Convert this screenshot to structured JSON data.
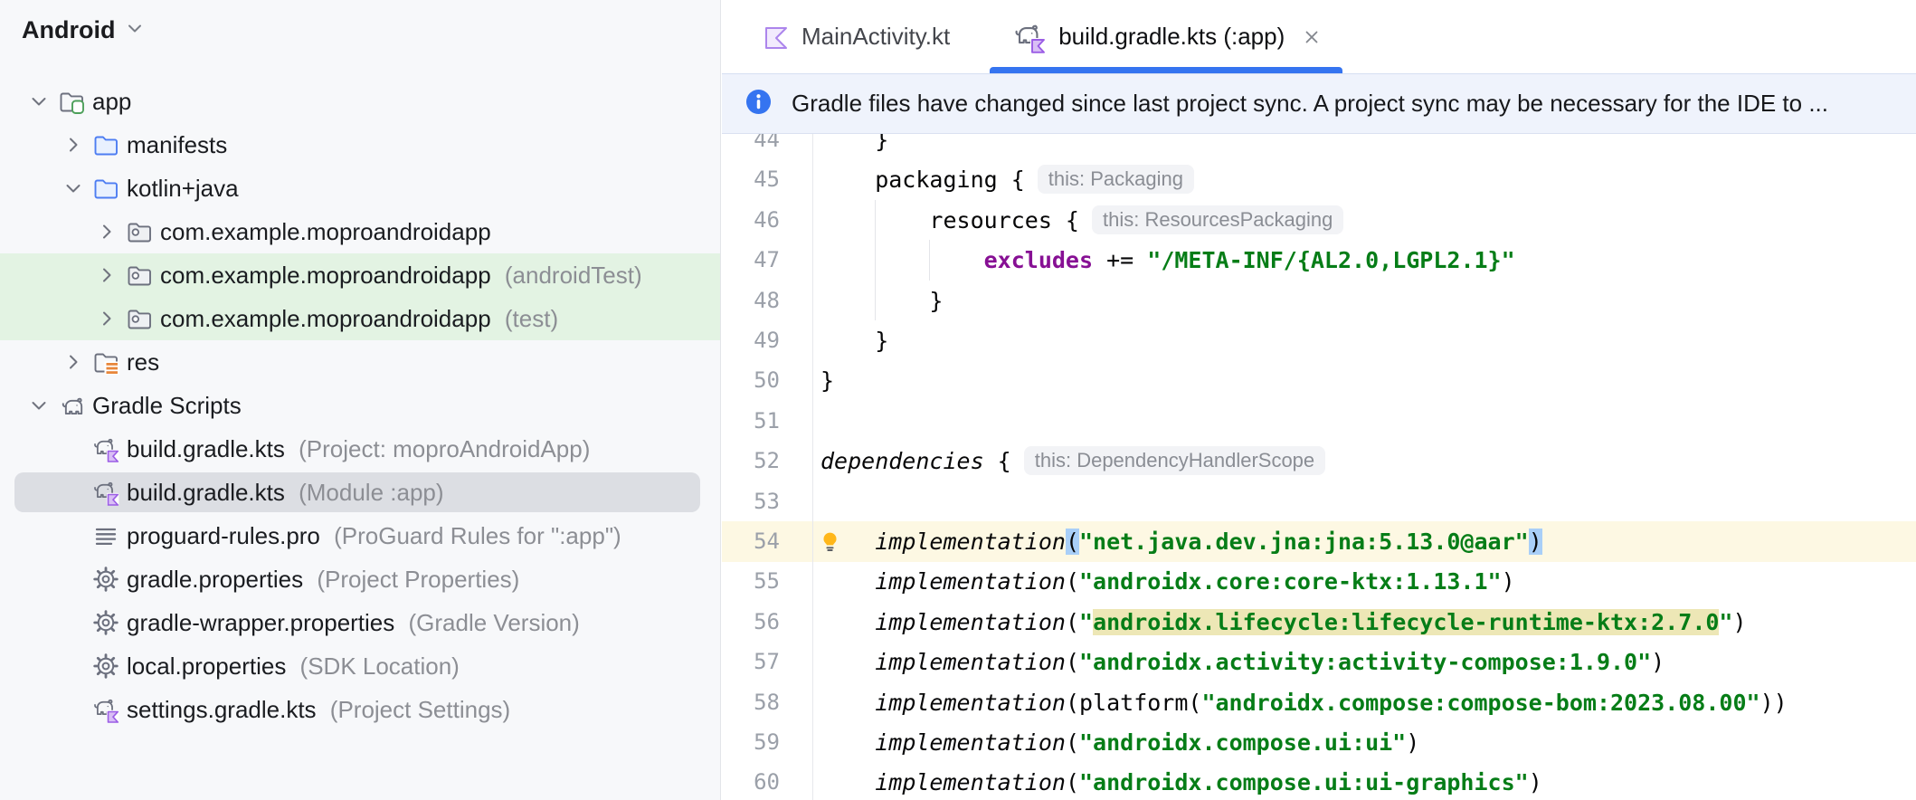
{
  "sidebar": {
    "view_selector": {
      "label": "Android"
    },
    "tree": [
      {
        "label": "app",
        "suffix": "",
        "icon": "folder-module",
        "chevron": "down",
        "indent": 0,
        "highlight": "none"
      },
      {
        "label": "manifests",
        "suffix": "",
        "icon": "folder-blue",
        "chevron": "right",
        "indent": 1,
        "highlight": "none"
      },
      {
        "label": "kotlin+java",
        "suffix": "",
        "icon": "folder-blue",
        "chevron": "down",
        "indent": 1,
        "highlight": "none"
      },
      {
        "label": "com.example.moproandroidapp",
        "suffix": "",
        "icon": "package-folder",
        "chevron": "right",
        "indent": 2,
        "highlight": "none"
      },
      {
        "label": "com.example.moproandroidapp",
        "suffix": "(androidTest)",
        "icon": "package-folder",
        "chevron": "right",
        "indent": 2,
        "highlight": "green"
      },
      {
        "label": "com.example.moproandroidapp",
        "suffix": "(test)",
        "icon": "package-folder",
        "chevron": "right",
        "indent": 2,
        "highlight": "green"
      },
      {
        "label": "res",
        "suffix": "",
        "icon": "folder-res",
        "chevron": "right",
        "indent": 1,
        "highlight": "none"
      },
      {
        "label": "Gradle Scripts",
        "suffix": "",
        "icon": "gradle-elephant",
        "chevron": "down",
        "indent": 0,
        "highlight": "none"
      },
      {
        "label": "build.gradle.kts",
        "suffix": "(Project: moproAndroidApp)",
        "icon": "gradle-kts",
        "chevron": "none",
        "indent": 1,
        "highlight": "none"
      },
      {
        "label": "build.gradle.kts",
        "suffix": "(Module :app)",
        "icon": "gradle-kts",
        "chevron": "none",
        "indent": 1,
        "highlight": "selected"
      },
      {
        "label": "proguard-rules.pro",
        "suffix": "(ProGuard Rules for \":app\")",
        "icon": "text-file",
        "chevron": "none",
        "indent": 1,
        "highlight": "none"
      },
      {
        "label": "gradle.properties",
        "suffix": "(Project Properties)",
        "icon": "gear",
        "chevron": "none",
        "indent": 1,
        "highlight": "none"
      },
      {
        "label": "gradle-wrapper.properties",
        "suffix": "(Gradle Version)",
        "icon": "gear",
        "chevron": "none",
        "indent": 1,
        "highlight": "none"
      },
      {
        "label": "local.properties",
        "suffix": "(SDK Location)",
        "icon": "gear",
        "chevron": "none",
        "indent": 1,
        "highlight": "none"
      },
      {
        "label": "settings.gradle.kts",
        "suffix": "(Project Settings)",
        "icon": "gradle-kts",
        "chevron": "none",
        "indent": 1,
        "highlight": "none"
      }
    ]
  },
  "editor": {
    "tabs": [
      {
        "label": "MainActivity.kt",
        "icon": "kotlin",
        "active": false,
        "closable": false
      },
      {
        "label": "build.gradle.kts (:app)",
        "icon": "gradle-kts",
        "active": true,
        "closable": true
      }
    ],
    "banner": {
      "icon": "info",
      "text": "Gradle files have changed since last project sync. A project sync may be necessary for the IDE to ..."
    },
    "code": {
      "first_line_number": 44,
      "guides": [
        {
          "col": 4,
          "from_line": 46,
          "to_line": 48
        },
        {
          "col": 8,
          "from_line": 47,
          "to_line": 47
        }
      ],
      "lines": [
        {
          "num": 44,
          "segments": [
            {
              "style": "plain",
              "text": "    }"
            }
          ]
        },
        {
          "num": 45,
          "segments": [
            {
              "style": "plain",
              "text": "    packaging {"
            }
          ],
          "inlay": "this: Packaging"
        },
        {
          "num": 46,
          "segments": [
            {
              "style": "plain",
              "text": "        resources {"
            }
          ],
          "inlay": "this: ResourcesPackaging"
        },
        {
          "num": 47,
          "segments": [
            {
              "style": "plain",
              "text": "            "
            },
            {
              "style": "prop",
              "text": "excludes"
            },
            {
              "style": "plain",
              "text": " += "
            },
            {
              "style": "str",
              "text": "\"/META-INF/{AL2.0,LGPL2.1}\""
            }
          ]
        },
        {
          "num": 48,
          "segments": [
            {
              "style": "plain",
              "text": "        }"
            }
          ]
        },
        {
          "num": 49,
          "segments": [
            {
              "style": "plain",
              "text": "    }"
            }
          ]
        },
        {
          "num": 50,
          "segments": [
            {
              "style": "plain",
              "text": "}"
            }
          ]
        },
        {
          "num": 51,
          "segments": []
        },
        {
          "num": 52,
          "segments": [
            {
              "style": "call",
              "text": "dependencies"
            },
            {
              "style": "plain",
              "text": " {"
            }
          ],
          "inlay": "this: DependencyHandlerScope"
        },
        {
          "num": 53,
          "segments": []
        },
        {
          "num": 54,
          "current": true,
          "bulb": true,
          "segments": [
            {
              "style": "plain",
              "text": "    "
            },
            {
              "style": "call",
              "text": "implementation"
            },
            {
              "style": "paren",
              "text": "("
            },
            {
              "style": "str",
              "text": "\"net.java.dev.jna:jna:5.13.0@aar\""
            },
            {
              "style": "paren",
              "text": ")"
            }
          ]
        },
        {
          "num": 55,
          "segments": [
            {
              "style": "plain",
              "text": "    "
            },
            {
              "style": "call",
              "text": "implementation"
            },
            {
              "style": "plain",
              "text": "("
            },
            {
              "style": "str",
              "text": "\"androidx.core:core-ktx:1.13.1\""
            },
            {
              "style": "plain",
              "text": ")"
            }
          ]
        },
        {
          "num": 56,
          "segments": [
            {
              "style": "plain",
              "text": "    "
            },
            {
              "style": "call",
              "text": "implementation"
            },
            {
              "style": "plain",
              "text": "("
            },
            {
              "style": "str",
              "text": "\""
            },
            {
              "style": "str-usage",
              "text": "androidx.lifecycle:lifecycle-runtime-ktx:2.7.0"
            },
            {
              "style": "str",
              "text": "\""
            },
            {
              "style": "plain",
              "text": ")"
            }
          ]
        },
        {
          "num": 57,
          "segments": [
            {
              "style": "plain",
              "text": "    "
            },
            {
              "style": "call",
              "text": "implementation"
            },
            {
              "style": "plain",
              "text": "("
            },
            {
              "style": "str",
              "text": "\"androidx.activity:activity-compose:1.9.0\""
            },
            {
              "style": "plain",
              "text": ")"
            }
          ]
        },
        {
          "num": 58,
          "segments": [
            {
              "style": "plain",
              "text": "    "
            },
            {
              "style": "call",
              "text": "implementation"
            },
            {
              "style": "plain",
              "text": "(platform("
            },
            {
              "style": "str",
              "text": "\"androidx.compose:compose-bom:2023.08.00\""
            },
            {
              "style": "plain",
              "text": "))"
            }
          ]
        },
        {
          "num": 59,
          "segments": [
            {
              "style": "plain",
              "text": "    "
            },
            {
              "style": "call",
              "text": "implementation"
            },
            {
              "style": "plain",
              "text": "("
            },
            {
              "style": "str",
              "text": "\"androidx.compose.ui:ui\""
            },
            {
              "style": "plain",
              "text": ")"
            }
          ]
        },
        {
          "num": 60,
          "segments": [
            {
              "style": "plain",
              "text": "    "
            },
            {
              "style": "call",
              "text": "implementation"
            },
            {
              "style": "plain",
              "text": "("
            },
            {
              "style": "str",
              "text": "\"androidx.compose.ui:ui-graphics\""
            },
            {
              "style": "plain",
              "text": ")"
            }
          ]
        }
      ]
    }
  },
  "colors": {
    "accent_blue": "#3574F0",
    "string_green": "#067D17",
    "property_purple": "#871094",
    "tree_green_highlight": "#E3F3E3",
    "tree_selected_gray": "#DCDEE3",
    "current_line_yellow": "#FDF8E3",
    "usage_highlight_tan": "#EDE7B6",
    "paren_match_blue": "#A9CFF8",
    "sidebar_bg": "#F7F8FA",
    "banner_bg": "#EFF3FC"
  }
}
